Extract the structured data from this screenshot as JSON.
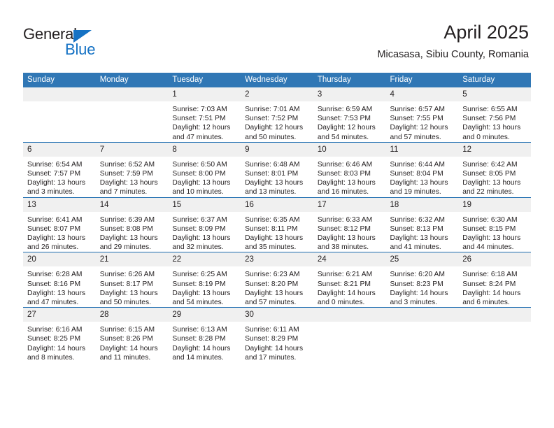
{
  "brand": {
    "name_part1": "General",
    "name_part2": "Blue",
    "logo_icon": "triangle-logo-icon"
  },
  "header": {
    "title": "April 2025",
    "subtitle": "Micasasa, Sibiu County, Romania",
    "accent_color": "#3077b5",
    "separator_color": "#1d6cb0",
    "daynum_bg": "#f0f0f0"
  },
  "weekdays": [
    "Sunday",
    "Monday",
    "Tuesday",
    "Wednesday",
    "Thursday",
    "Friday",
    "Saturday"
  ],
  "weeks": [
    [
      {
        "day": "",
        "sunrise": "",
        "sunset": "",
        "daylight1": "",
        "daylight2": ""
      },
      {
        "day": "",
        "sunrise": "",
        "sunset": "",
        "daylight1": "",
        "daylight2": ""
      },
      {
        "day": "1",
        "sunrise": "Sunrise: 7:03 AM",
        "sunset": "Sunset: 7:51 PM",
        "daylight1": "Daylight: 12 hours",
        "daylight2": "and 47 minutes."
      },
      {
        "day": "2",
        "sunrise": "Sunrise: 7:01 AM",
        "sunset": "Sunset: 7:52 PM",
        "daylight1": "Daylight: 12 hours",
        "daylight2": "and 50 minutes."
      },
      {
        "day": "3",
        "sunrise": "Sunrise: 6:59 AM",
        "sunset": "Sunset: 7:53 PM",
        "daylight1": "Daylight: 12 hours",
        "daylight2": "and 54 minutes."
      },
      {
        "day": "4",
        "sunrise": "Sunrise: 6:57 AM",
        "sunset": "Sunset: 7:55 PM",
        "daylight1": "Daylight: 12 hours",
        "daylight2": "and 57 minutes."
      },
      {
        "day": "5",
        "sunrise": "Sunrise: 6:55 AM",
        "sunset": "Sunset: 7:56 PM",
        "daylight1": "Daylight: 13 hours",
        "daylight2": "and 0 minutes."
      }
    ],
    [
      {
        "day": "6",
        "sunrise": "Sunrise: 6:54 AM",
        "sunset": "Sunset: 7:57 PM",
        "daylight1": "Daylight: 13 hours",
        "daylight2": "and 3 minutes."
      },
      {
        "day": "7",
        "sunrise": "Sunrise: 6:52 AM",
        "sunset": "Sunset: 7:59 PM",
        "daylight1": "Daylight: 13 hours",
        "daylight2": "and 7 minutes."
      },
      {
        "day": "8",
        "sunrise": "Sunrise: 6:50 AM",
        "sunset": "Sunset: 8:00 PM",
        "daylight1": "Daylight: 13 hours",
        "daylight2": "and 10 minutes."
      },
      {
        "day": "9",
        "sunrise": "Sunrise: 6:48 AM",
        "sunset": "Sunset: 8:01 PM",
        "daylight1": "Daylight: 13 hours",
        "daylight2": "and 13 minutes."
      },
      {
        "day": "10",
        "sunrise": "Sunrise: 6:46 AM",
        "sunset": "Sunset: 8:03 PM",
        "daylight1": "Daylight: 13 hours",
        "daylight2": "and 16 minutes."
      },
      {
        "day": "11",
        "sunrise": "Sunrise: 6:44 AM",
        "sunset": "Sunset: 8:04 PM",
        "daylight1": "Daylight: 13 hours",
        "daylight2": "and 19 minutes."
      },
      {
        "day": "12",
        "sunrise": "Sunrise: 6:42 AM",
        "sunset": "Sunset: 8:05 PM",
        "daylight1": "Daylight: 13 hours",
        "daylight2": "and 22 minutes."
      }
    ],
    [
      {
        "day": "13",
        "sunrise": "Sunrise: 6:41 AM",
        "sunset": "Sunset: 8:07 PM",
        "daylight1": "Daylight: 13 hours",
        "daylight2": "and 26 minutes."
      },
      {
        "day": "14",
        "sunrise": "Sunrise: 6:39 AM",
        "sunset": "Sunset: 8:08 PM",
        "daylight1": "Daylight: 13 hours",
        "daylight2": "and 29 minutes."
      },
      {
        "day": "15",
        "sunrise": "Sunrise: 6:37 AM",
        "sunset": "Sunset: 8:09 PM",
        "daylight1": "Daylight: 13 hours",
        "daylight2": "and 32 minutes."
      },
      {
        "day": "16",
        "sunrise": "Sunrise: 6:35 AM",
        "sunset": "Sunset: 8:11 PM",
        "daylight1": "Daylight: 13 hours",
        "daylight2": "and 35 minutes."
      },
      {
        "day": "17",
        "sunrise": "Sunrise: 6:33 AM",
        "sunset": "Sunset: 8:12 PM",
        "daylight1": "Daylight: 13 hours",
        "daylight2": "and 38 minutes."
      },
      {
        "day": "18",
        "sunrise": "Sunrise: 6:32 AM",
        "sunset": "Sunset: 8:13 PM",
        "daylight1": "Daylight: 13 hours",
        "daylight2": "and 41 minutes."
      },
      {
        "day": "19",
        "sunrise": "Sunrise: 6:30 AM",
        "sunset": "Sunset: 8:15 PM",
        "daylight1": "Daylight: 13 hours",
        "daylight2": "and 44 minutes."
      }
    ],
    [
      {
        "day": "20",
        "sunrise": "Sunrise: 6:28 AM",
        "sunset": "Sunset: 8:16 PM",
        "daylight1": "Daylight: 13 hours",
        "daylight2": "and 47 minutes."
      },
      {
        "day": "21",
        "sunrise": "Sunrise: 6:26 AM",
        "sunset": "Sunset: 8:17 PM",
        "daylight1": "Daylight: 13 hours",
        "daylight2": "and 50 minutes."
      },
      {
        "day": "22",
        "sunrise": "Sunrise: 6:25 AM",
        "sunset": "Sunset: 8:19 PM",
        "daylight1": "Daylight: 13 hours",
        "daylight2": "and 54 minutes."
      },
      {
        "day": "23",
        "sunrise": "Sunrise: 6:23 AM",
        "sunset": "Sunset: 8:20 PM",
        "daylight1": "Daylight: 13 hours",
        "daylight2": "and 57 minutes."
      },
      {
        "day": "24",
        "sunrise": "Sunrise: 6:21 AM",
        "sunset": "Sunset: 8:21 PM",
        "daylight1": "Daylight: 14 hours",
        "daylight2": "and 0 minutes."
      },
      {
        "day": "25",
        "sunrise": "Sunrise: 6:20 AM",
        "sunset": "Sunset: 8:23 PM",
        "daylight1": "Daylight: 14 hours",
        "daylight2": "and 3 minutes."
      },
      {
        "day": "26",
        "sunrise": "Sunrise: 6:18 AM",
        "sunset": "Sunset: 8:24 PM",
        "daylight1": "Daylight: 14 hours",
        "daylight2": "and 6 minutes."
      }
    ],
    [
      {
        "day": "27",
        "sunrise": "Sunrise: 6:16 AM",
        "sunset": "Sunset: 8:25 PM",
        "daylight1": "Daylight: 14 hours",
        "daylight2": "and 8 minutes."
      },
      {
        "day": "28",
        "sunrise": "Sunrise: 6:15 AM",
        "sunset": "Sunset: 8:26 PM",
        "daylight1": "Daylight: 14 hours",
        "daylight2": "and 11 minutes."
      },
      {
        "day": "29",
        "sunrise": "Sunrise: 6:13 AM",
        "sunset": "Sunset: 8:28 PM",
        "daylight1": "Daylight: 14 hours",
        "daylight2": "and 14 minutes."
      },
      {
        "day": "30",
        "sunrise": "Sunrise: 6:11 AM",
        "sunset": "Sunset: 8:29 PM",
        "daylight1": "Daylight: 14 hours",
        "daylight2": "and 17 minutes."
      },
      {
        "day": "",
        "sunrise": "",
        "sunset": "",
        "daylight1": "",
        "daylight2": ""
      },
      {
        "day": "",
        "sunrise": "",
        "sunset": "",
        "daylight1": "",
        "daylight2": ""
      },
      {
        "day": "",
        "sunrise": "",
        "sunset": "",
        "daylight1": "",
        "daylight2": ""
      }
    ]
  ]
}
